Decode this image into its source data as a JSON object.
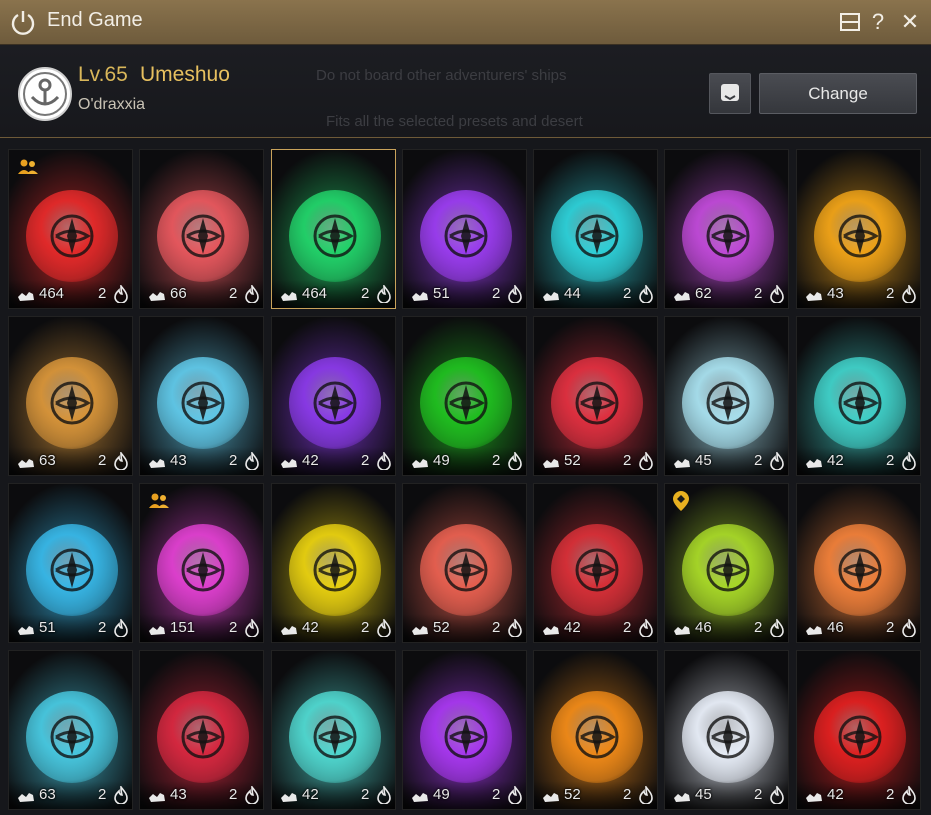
{
  "window": {
    "title": "End Game",
    "icons": [
      "power-icon",
      "window-icon",
      "help-icon",
      "close-icon"
    ],
    "help_glyph": "?",
    "close_glyph": "✕"
  },
  "header": {
    "level": "Lv.65",
    "name": "Umeshuo",
    "server": "O'draxxia",
    "change_label": "Change",
    "ghost_lines": [
      "Do not board other adventurers' ships",
      "Fits all the selected presets and desert"
    ]
  },
  "colors": {
    "accent": "#e7c05f",
    "title_bar": "#7a6544",
    "selected_border": "#c9a35b"
  },
  "cards": [
    {
      "count": "464",
      "revive": "2",
      "color": "#e52a2a",
      "badge": "party"
    },
    {
      "count": "66",
      "revive": "2",
      "color": "#e8585e",
      "badge": ""
    },
    {
      "count": "464",
      "revive": "2",
      "color": "#22d36a",
      "badge": "",
      "selected": true
    },
    {
      "count": "51",
      "revive": "2",
      "color": "#9b3df0",
      "badge": ""
    },
    {
      "count": "44",
      "revive": "2",
      "color": "#2ed0d8",
      "badge": ""
    },
    {
      "count": "62",
      "revive": "2",
      "color": "#c04ad8",
      "badge": ""
    },
    {
      "count": "43",
      "revive": "2",
      "color": "#f0a318",
      "badge": ""
    },
    {
      "count": "63",
      "revive": "2",
      "color": "#d8953a",
      "badge": ""
    },
    {
      "count": "43",
      "revive": "2",
      "color": "#60c8e8",
      "badge": ""
    },
    {
      "count": "42",
      "revive": "2",
      "color": "#8a3ae8",
      "badge": ""
    },
    {
      "count": "49",
      "revive": "2",
      "color": "#20c020",
      "badge": ""
    },
    {
      "count": "52",
      "revive": "2",
      "color": "#e03040",
      "badge": ""
    },
    {
      "count": "45",
      "revive": "2",
      "color": "#a8e0ee",
      "badge": ""
    },
    {
      "count": "42",
      "revive": "2",
      "color": "#40d0c8",
      "badge": ""
    },
    {
      "count": "51",
      "revive": "2",
      "color": "#38b8e8",
      "badge": ""
    },
    {
      "count": "151",
      "revive": "2",
      "color": "#e040d0",
      "badge": "party"
    },
    {
      "count": "42",
      "revive": "2",
      "color": "#e8d010",
      "badge": ""
    },
    {
      "count": "52",
      "revive": "2",
      "color": "#e86050",
      "badge": ""
    },
    {
      "count": "42",
      "revive": "2",
      "color": "#d83038",
      "badge": ""
    },
    {
      "count": "46",
      "revive": "2",
      "color": "#a8d828",
      "badge": "marker"
    },
    {
      "count": "46",
      "revive": "2",
      "color": "#f0803a",
      "badge": ""
    },
    {
      "count": "63",
      "revive": "2",
      "color": "#48c8e0",
      "badge": ""
    },
    {
      "count": "43",
      "revive": "2",
      "color": "#d82840",
      "badge": ""
    },
    {
      "count": "42",
      "revive": "2",
      "color": "#50d8d0",
      "badge": ""
    },
    {
      "count": "49",
      "revive": "2",
      "color": "#a838f0",
      "badge": ""
    },
    {
      "count": "52",
      "revive": "2",
      "color": "#f08a18",
      "badge": ""
    },
    {
      "count": "45",
      "revive": "2",
      "color": "#e8eef8",
      "badge": ""
    },
    {
      "count": "42",
      "revive": "2",
      "color": "#e02020",
      "badge": ""
    }
  ]
}
